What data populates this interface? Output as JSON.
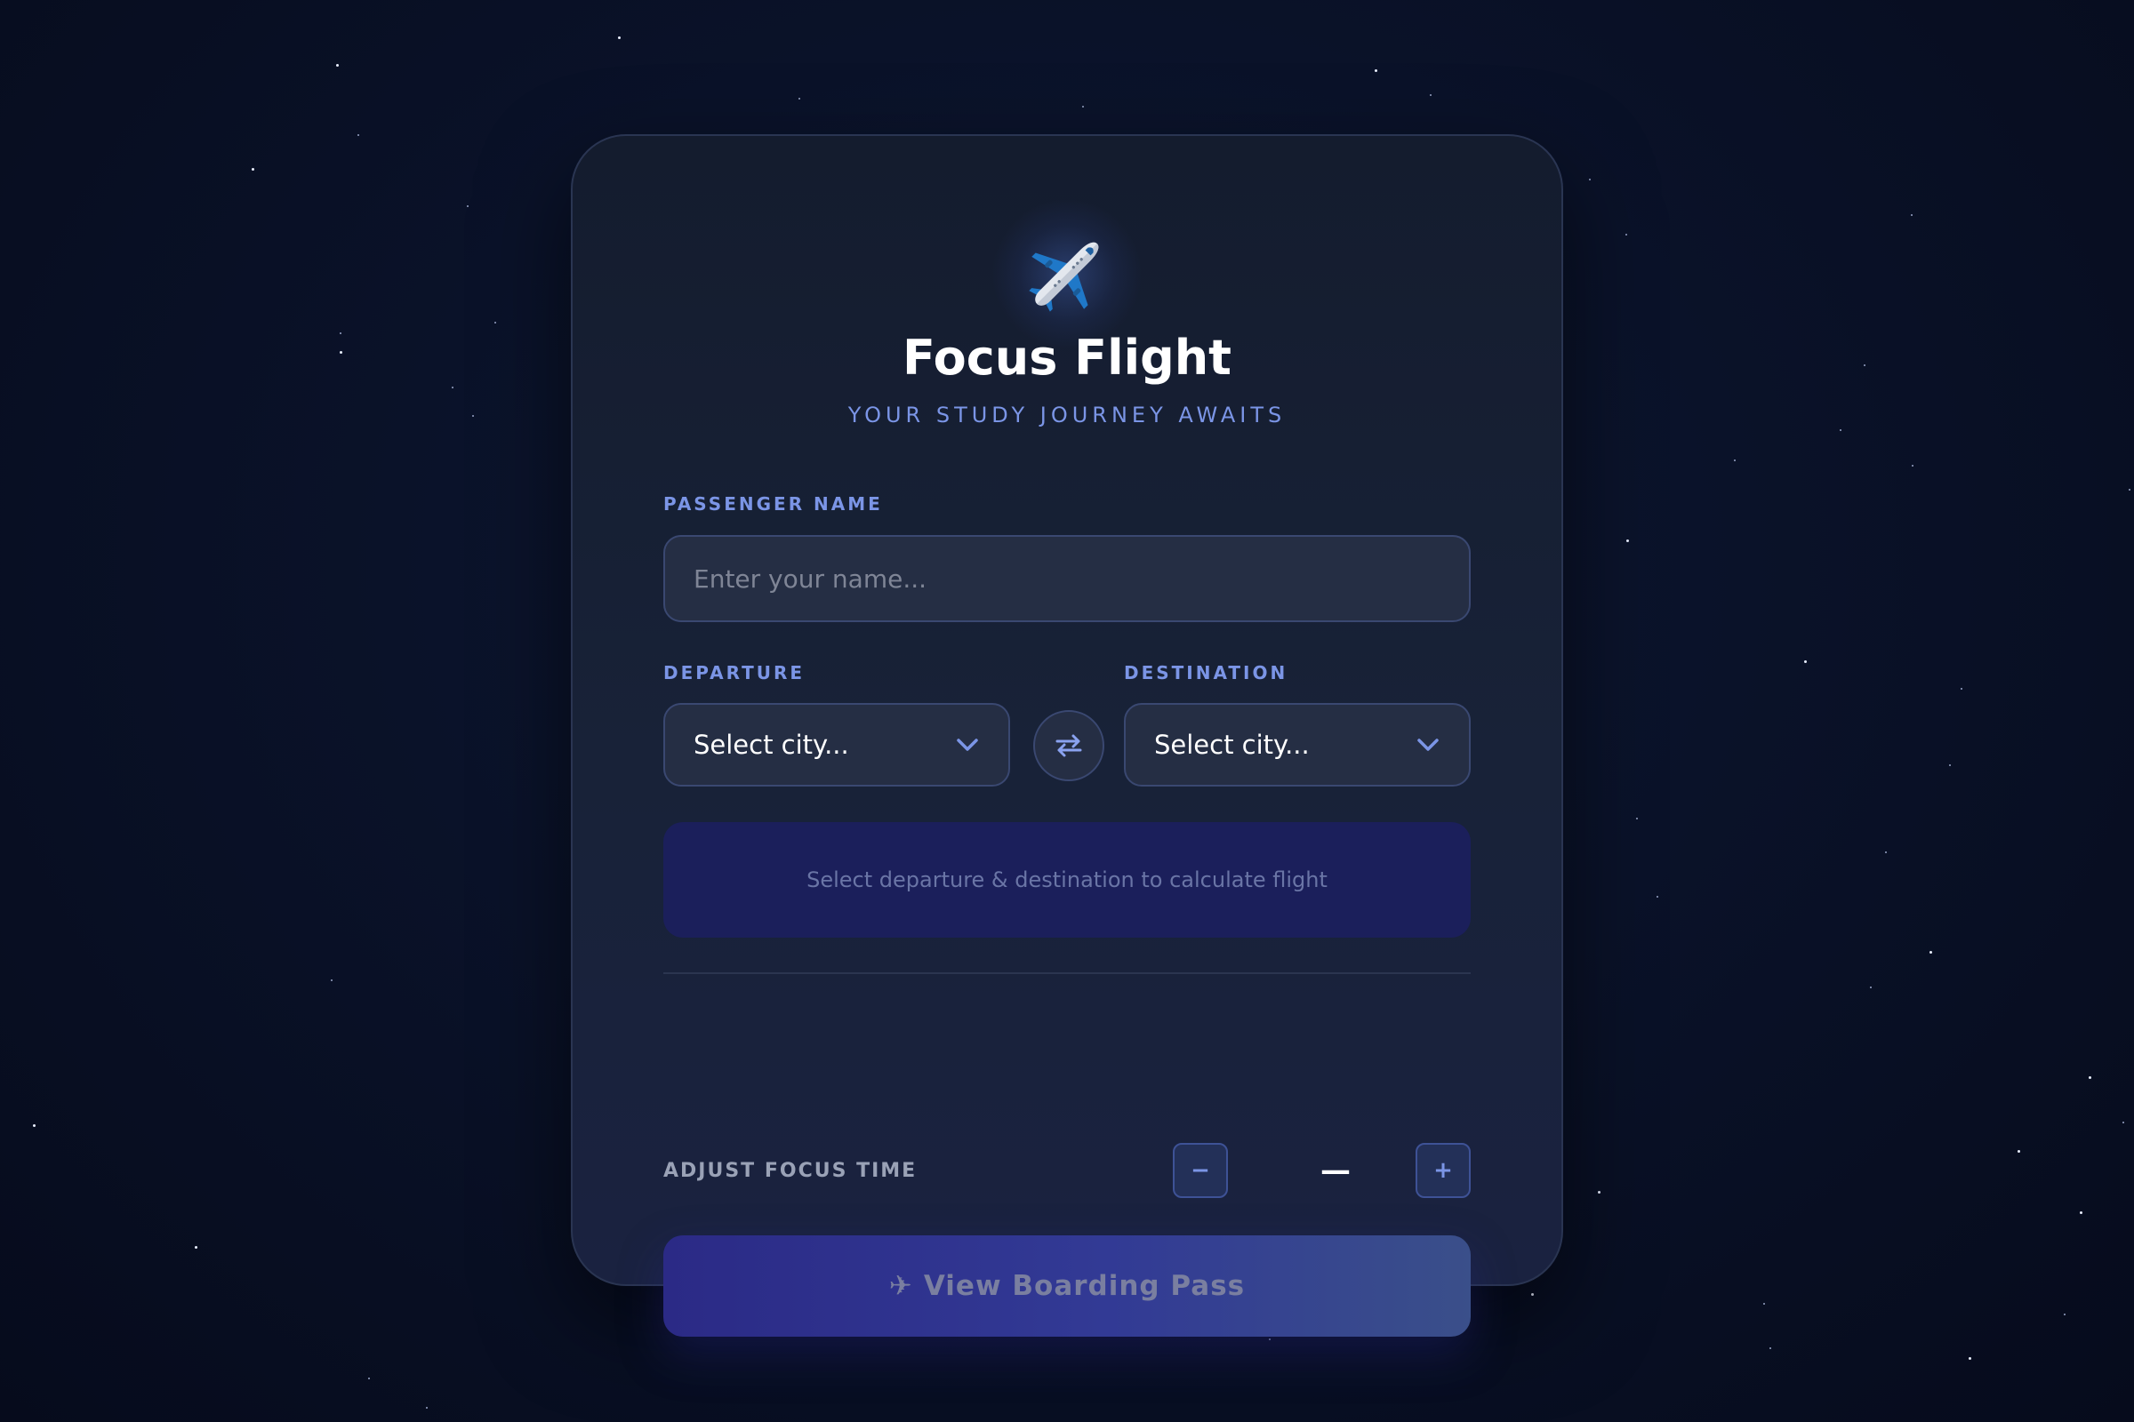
{
  "app": {
    "icon": "airplane-icon",
    "title": "Focus Flight",
    "subtitle": "YOUR STUDY JOURNEY AWAITS"
  },
  "passenger": {
    "label": "PASSENGER NAME",
    "placeholder": "Enter your name...",
    "value": ""
  },
  "route": {
    "departure_label": "DEPARTURE",
    "departure_value": "Select city...",
    "destination_label": "DESTINATION",
    "destination_value": "Select city...",
    "swap_icon": "swap-arrows-icon"
  },
  "flight_info": {
    "message": "Select departure & destination to calculate flight"
  },
  "focus_time": {
    "label": "ADJUST FOCUS TIME",
    "decrement_label": "−",
    "increment_label": "+",
    "value": "—"
  },
  "cta": {
    "icon": "✈",
    "label": "View Boarding Pass"
  },
  "colors": {
    "background": "#0a1229",
    "card": "#182238",
    "accent": "#7b95e6",
    "info_panel": "#1b1f5b",
    "cta": "#2b2a86"
  }
}
